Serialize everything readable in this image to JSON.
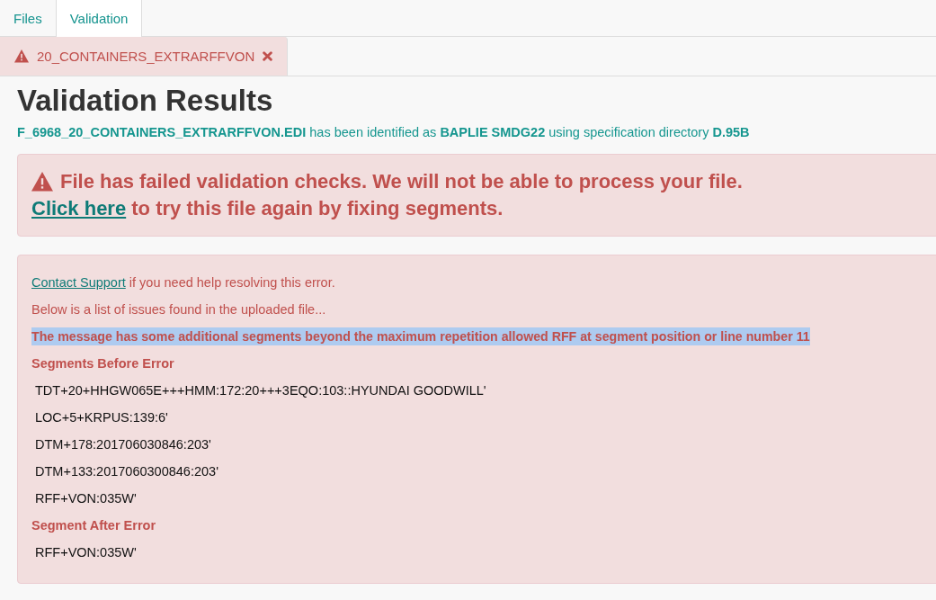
{
  "tabs": [
    {
      "label": "Files",
      "selected": false
    },
    {
      "label": "Validation",
      "selected": true
    }
  ],
  "file_tab": {
    "label": "20_CONTAINERS_EXTRARFFVON",
    "kind": "error",
    "closable": true
  },
  "heading": "Validation Results",
  "identified": "**F_6968_20_CONTAINERS_EXTRARFFVON.EDI** has been identified as **BAPLIE SMDG22** using specification directory **D.95B**",
  "alert": {
    "kind": "error",
    "message": "File has failed validation checks. We will not be able to process your file.",
    "link": "Click here",
    "link_suffix": " to try this file again by fixing segments."
  },
  "details": {
    "support_link": "Contact Support",
    "support_suffix": " if you need help resolving this error.",
    "intro": "Below is a list of issues found in the uploaded file...",
    "issue": {
      "text": "The message has some additional segments beyond the maximum repetition allowed RFF at segment position or line number 11",
      "highlighted": true
    },
    "sections": [
      {
        "title": "Segments Before Error",
        "segments": [
          "TDT+20+HHGW065E+++HMM:172:20+++3EQO:103::HYUNDAI GOODWILL'",
          "LOC+5+KRPUS:139:6'",
          "DTM+178:201706030846:203'",
          "DTM+133:2017060300846:203'",
          "RFF+VON:035W'"
        ]
      },
      {
        "title": "Segment After Error",
        "segments": [
          "RFF+VON:035W'"
        ]
      }
    ]
  }
}
